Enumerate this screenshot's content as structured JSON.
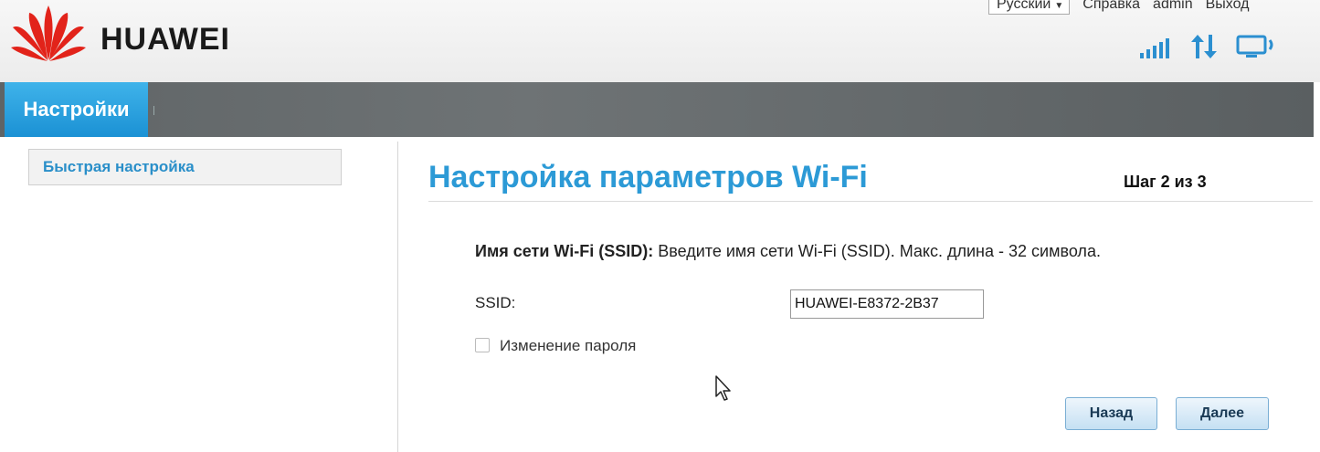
{
  "header": {
    "brand": "HUAWEI",
    "language": "Русский",
    "help_link": "Справка",
    "user": "admin",
    "logout_link": "Выход"
  },
  "nav": {
    "active_tab": "Настройки"
  },
  "sidebar": {
    "items": [
      {
        "label": "Быстрая настройка"
      }
    ]
  },
  "main": {
    "title": "Настройка параметров Wi-Fi",
    "step": "Шаг 2 из 3",
    "ssid_desc_bold": "Имя сети Wi-Fi (SSID):",
    "ssid_desc": " Введите имя сети Wi-Fi (SSID). Макс. длина - 32 символа.",
    "ssid_label": "SSID:",
    "ssid_value": "HUAWEI-E8372-2B37",
    "change_password_label": "Изменение пароля",
    "change_password_checked": false,
    "back_button": "Назад",
    "next_button": "Далее"
  },
  "colors": {
    "accent": "#2c9ad6",
    "nav_bar": "#64696b",
    "logo_red": "#e2231a"
  },
  "icons": [
    "huawei-logo",
    "signal-strength-icon",
    "data-transfer-icon",
    "monitor-connection-icon",
    "mouse-cursor-icon"
  ]
}
